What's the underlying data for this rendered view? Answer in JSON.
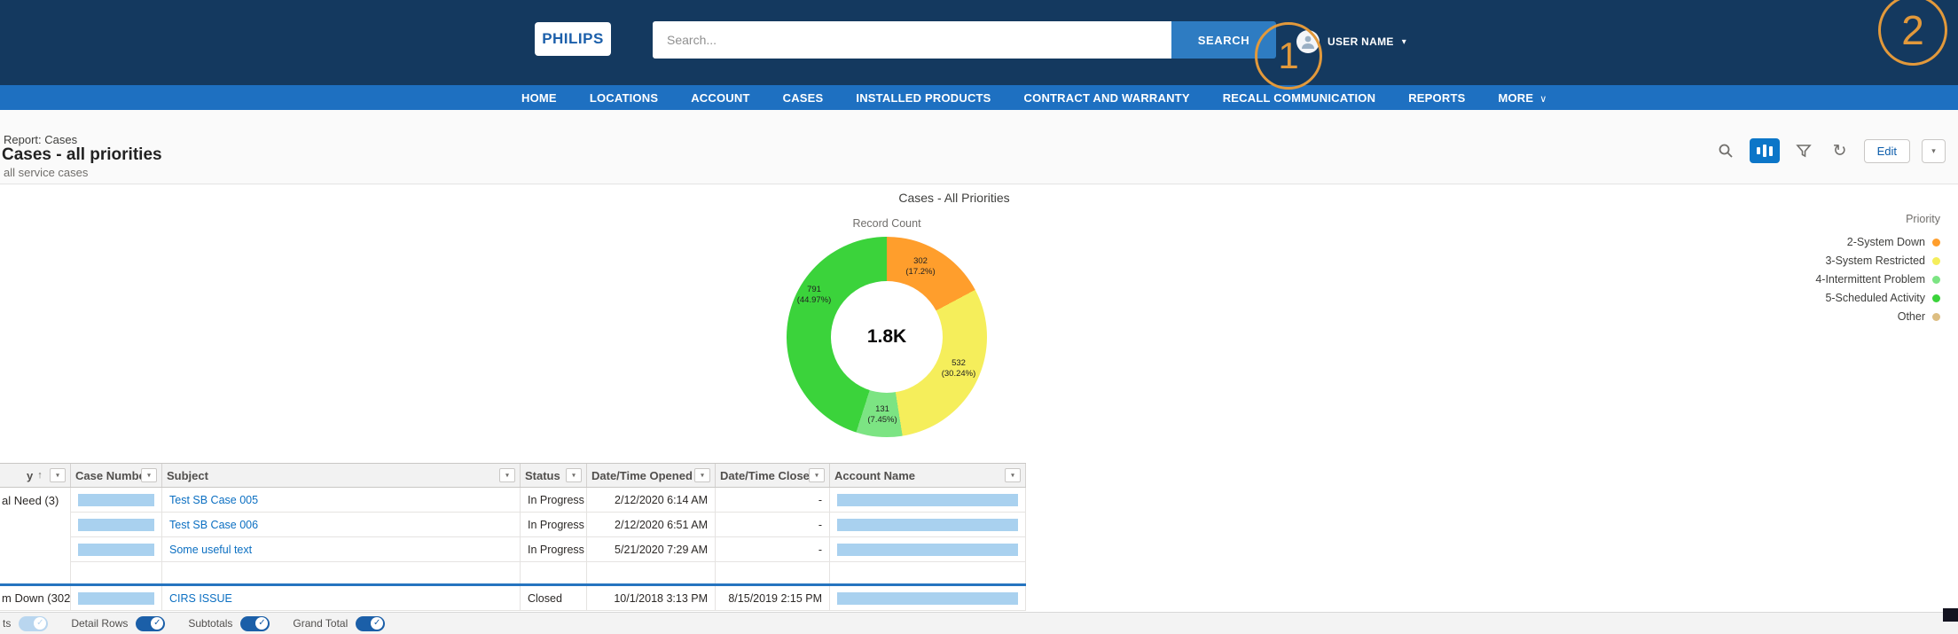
{
  "icons": {
    "user_caret": "▾",
    "more_chevron": "∨",
    "filter_caret": "▾",
    "refresh": "↻",
    "edit_caret": "▾",
    "check": "✓"
  },
  "annotations": {
    "step1": "1",
    "step2": "2"
  },
  "header": {
    "logo_text": "PHILIPS",
    "search_placeholder": "Search...",
    "search_button_label": "SEARCH",
    "user_name": "USER NAME"
  },
  "nav": {
    "items": [
      "HOME",
      "LOCATIONS",
      "ACCOUNT",
      "CASES",
      "INSTALLED PRODUCTS",
      "CONTRACT AND WARRANTY",
      "RECALL COMMUNICATION",
      "REPORTS",
      "MORE"
    ]
  },
  "report_header": {
    "kicker": "Report: Cases",
    "title": "Cases - all priorities",
    "subtitle": "all service cases",
    "edit_label": "Edit"
  },
  "chart_data": {
    "type": "pie",
    "donut": true,
    "title": "Cases - All Priorities",
    "measure_label": "Record Count",
    "center_label": "1.8K",
    "total": 1756,
    "legend_title": "Priority",
    "legend_position": "right",
    "segments": [
      {
        "label": "2-System Down",
        "value": 302,
        "pct_label": "(17.2%)",
        "color": "#FF9E2C"
      },
      {
        "label": "3-System Restricted",
        "value": 532,
        "pct_label": "(30.24%)",
        "color": "#F5EE5B"
      },
      {
        "label": "4-Intermittent Problem",
        "value": 131,
        "pct_label": "(7.45%)",
        "color": "#7CE483"
      },
      {
        "label": "5-Scheduled Activity",
        "value": 791,
        "pct_label": "(44.97%)",
        "color": "#3BD33B"
      },
      {
        "label": "Other",
        "value": 0,
        "pct_label": "",
        "color": "#DDBE82"
      }
    ]
  },
  "table": {
    "columns": [
      {
        "label": "y",
        "sort": "↑"
      },
      {
        "label": "Case Number",
        "sort": ""
      },
      {
        "label": "Subject",
        "sort": ""
      },
      {
        "label": "Status",
        "sort": ""
      },
      {
        "label": "Date/Time Opened",
        "sort": "↑"
      },
      {
        "label": "Date/Time Closed",
        "sort": ""
      },
      {
        "label": "Account Name",
        "sort": ""
      }
    ],
    "group1_label": "al Need (3)",
    "group2_label": "m Down (302)",
    "rows": [
      {
        "subject": "Test SB Case 005",
        "status": "In Progress",
        "opened": "2/12/2020 6:14 AM",
        "closed": "-"
      },
      {
        "subject": "Test SB Case 006",
        "status": "In Progress",
        "opened": "2/12/2020 6:51 AM",
        "closed": "-"
      },
      {
        "subject": "Some useful text",
        "status": "In Progress",
        "opened": "5/21/2020 7:29 AM",
        "closed": "-"
      },
      {
        "subject": "CIRS ISSUE",
        "status": "Closed",
        "opened": "10/1/2018 3:13 PM",
        "closed": "8/15/2019 2:15 PM"
      }
    ]
  },
  "footer": {
    "toggles": [
      {
        "label": "ts",
        "state": "disabled"
      },
      {
        "label": "Detail Rows",
        "state": "on"
      },
      {
        "label": "Subtotals",
        "state": "on"
      },
      {
        "label": "Grand Total",
        "state": "on"
      }
    ]
  }
}
